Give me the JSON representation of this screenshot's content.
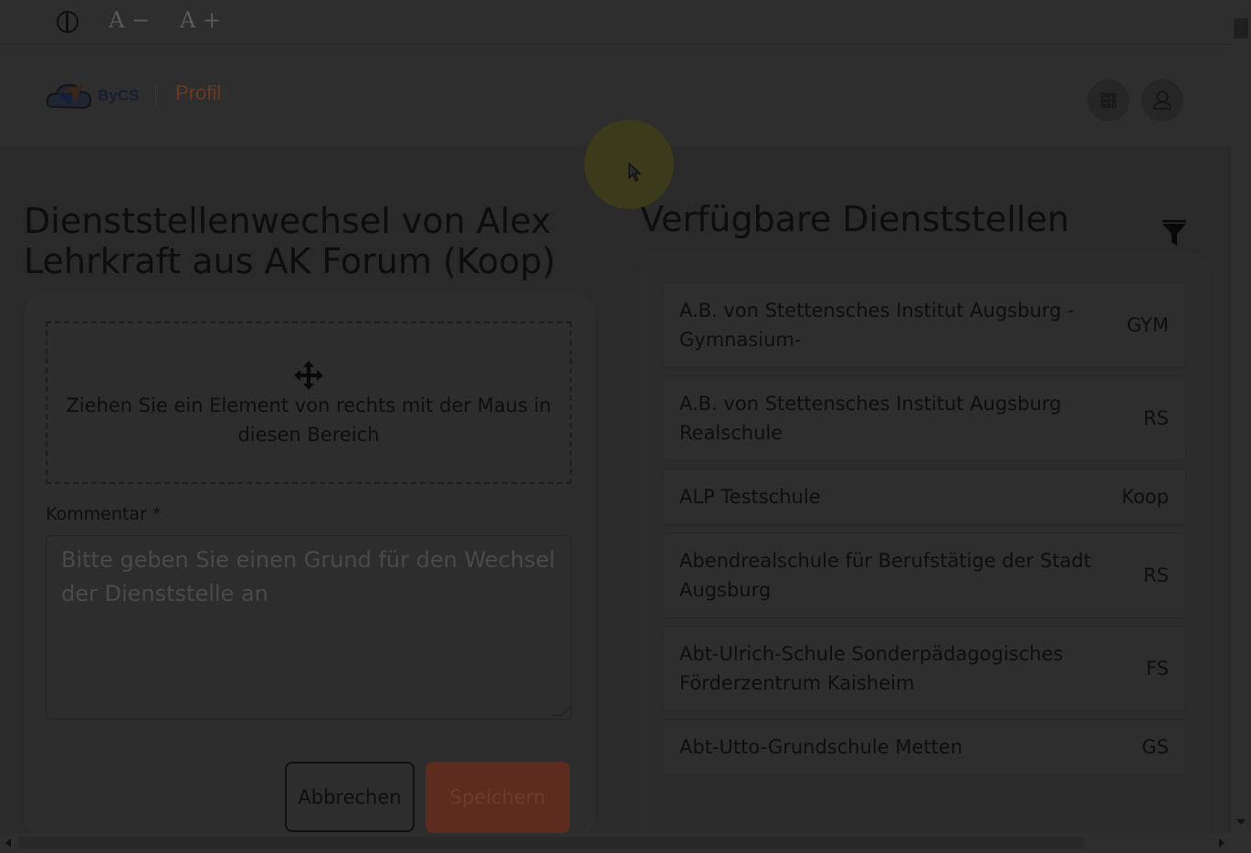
{
  "toolbar": {
    "font_decrease_label": "A −",
    "font_increase_label": "A +"
  },
  "header": {
    "logo_text": "ByCS",
    "section_title": "Profil"
  },
  "left": {
    "title": "Dienststellenwechsel von Alex Lehrkraft aus AK Forum (Koop)",
    "dropzone_text": "Ziehen Sie ein Element von rechts mit der Maus in diesen Bereich",
    "comment_label": "Kommentar *",
    "comment_placeholder": "Bitte geben Sie einen Grund für den Wechsel der Dienststelle an",
    "cancel_label": "Abbrechen",
    "save_label": "Speichern"
  },
  "right": {
    "title": "Verfügbare Dienststellen",
    "items": [
      {
        "name": "A.B. von Stettensches Institut Augsburg - Gymnasium-",
        "type": "GYM"
      },
      {
        "name": "A.B. von Stettensches Institut Augsburg Realschule",
        "type": "RS"
      },
      {
        "name": "ALP Testschule",
        "type": "Koop"
      },
      {
        "name": "Abendrealschule für Berufstätige der Stadt Augsburg",
        "type": "RS"
      },
      {
        "name": "Abt-Ulrich-Schule Sonderpädagogisches Förderzentrum Kaisheim",
        "type": "FS"
      },
      {
        "name": "Abt-Utto-Grundschule Metten",
        "type": "GS"
      }
    ]
  },
  "colors": {
    "overlay_bg": "#2f2f2f",
    "accent_orange": "#6a3a20",
    "save_button_bg": "#5e2c1e",
    "cursor_highlight": "#3b3a1a"
  }
}
